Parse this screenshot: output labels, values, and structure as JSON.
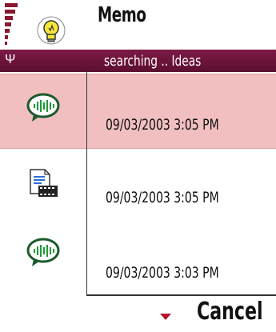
{
  "header": {
    "title": "Memo",
    "app_icon": "lightbulb-icon",
    "signal_icon": "signal-strength-icon"
  },
  "navi": {
    "antenna_icon": "antenna-icon",
    "antenna_glyph": "Ψ",
    "search_text": "searching .. Ideas"
  },
  "list": {
    "items": [
      {
        "icon": "voice-memo-icon",
        "date": "09/03/2003 3:05 PM",
        "selected": true
      },
      {
        "icon": "video-document-icon",
        "date": "09/03/2003 3:05 PM",
        "selected": false
      },
      {
        "icon": "voice-memo-icon",
        "date": "09/03/2003 3:03 PM",
        "selected": false
      }
    ]
  },
  "softkeys": {
    "scroll_indicator": "down-arrow-icon",
    "right_label": "Cancel"
  },
  "colors": {
    "accent": "#7c1a45",
    "selection": "#f2bfc0",
    "signal": "#8a1730"
  }
}
